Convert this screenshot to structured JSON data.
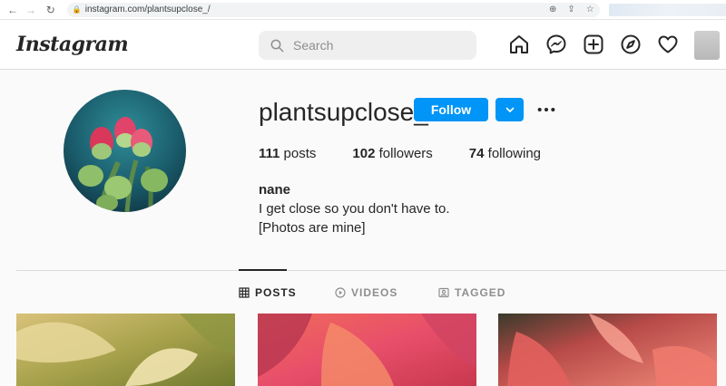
{
  "browser": {
    "url": "instagram.com/plantsupclose_/"
  },
  "header": {
    "logo": "Instagram",
    "search_placeholder": "Search"
  },
  "profile": {
    "username": "plantsupclose_",
    "follow_label": "Follow",
    "stats": {
      "posts_count": "111",
      "posts_label": "posts",
      "followers_count": "102",
      "followers_label": "followers",
      "following_count": "74",
      "following_label": "following"
    },
    "bio": {
      "name": "nane",
      "line1": "I get close so you don't have to.",
      "line2": "[Photos are mine]"
    }
  },
  "tabs": [
    {
      "label": "POSTS",
      "active": true
    },
    {
      "label": "VIDEOS",
      "active": false
    },
    {
      "label": "TAGGED",
      "active": false
    }
  ],
  "colors": {
    "accent": "#0095f6",
    "background": "#fafafa",
    "text": "#262626",
    "muted": "#8e8e8e"
  }
}
